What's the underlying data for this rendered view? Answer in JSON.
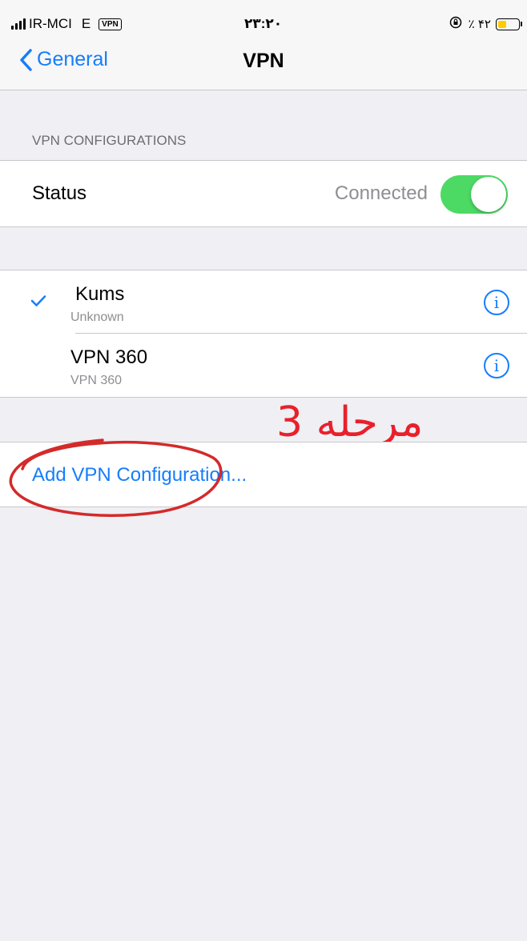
{
  "status_bar": {
    "carrier": "IR-MCI",
    "network": "E",
    "vpn_badge": "VPN",
    "time": "۲۳:۲۰",
    "battery_percent": "٪ ۴۲",
    "battery_level": 0.42,
    "battery_color": "#ffcc00"
  },
  "nav": {
    "back_label": "General",
    "title": "VPN"
  },
  "section_header": "VPN CONFIGURATIONS",
  "status": {
    "label": "Status",
    "value": "Connected",
    "toggle_on": true,
    "toggle_color": "#4cd964"
  },
  "vpn_list": [
    {
      "name": "Kums",
      "subtitle": "Unknown",
      "selected": true
    },
    {
      "name": "VPN 360",
      "subtitle": "VPN 360",
      "selected": false
    }
  ],
  "info_glyph": "i",
  "add_config_label": "Add VPN Configuration...",
  "annotation": {
    "text": "مرحله 3",
    "color": "#e8202a"
  },
  "colors": {
    "accent": "#157efb",
    "background": "#efeff4"
  }
}
